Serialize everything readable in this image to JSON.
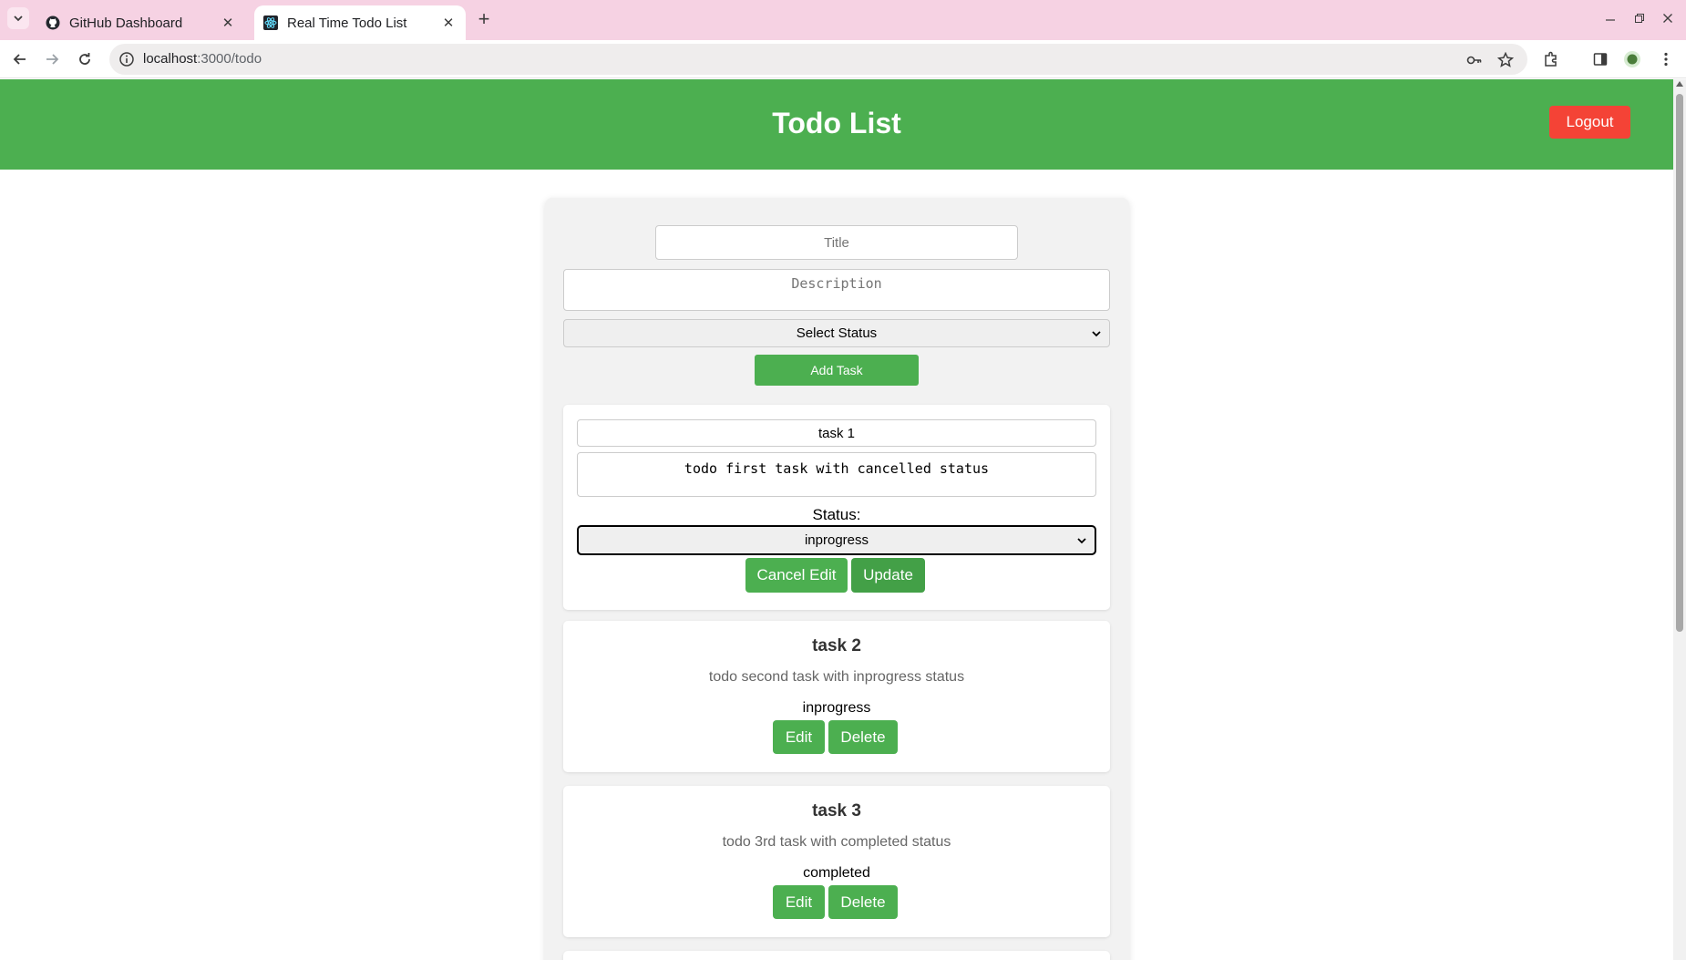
{
  "browser": {
    "tabs": [
      {
        "title": "GitHub Dashboard",
        "icon": "github-icon"
      },
      {
        "title": "Real Time Todo List",
        "icon": "react-icon"
      }
    ],
    "url_host": "localhost",
    "url_path": ":3000/todo"
  },
  "header": {
    "title": "Todo List",
    "logout_label": "Logout"
  },
  "new_task_form": {
    "title_placeholder": "Title",
    "description_placeholder": "Description",
    "status_selected": "Select Status",
    "add_label": "Add Task"
  },
  "editing_task": {
    "title_value": "task 1",
    "description_value": "todo first task with cancelled status",
    "status_label": "Status:",
    "status_selected": "inprogress",
    "cancel_label": "Cancel Edit",
    "update_label": "Update"
  },
  "tasks": [
    {
      "title": "task 2",
      "description": "todo second task with inprogress status",
      "status": "inprogress",
      "edit_label": "Edit",
      "delete_label": "Delete"
    },
    {
      "title": "task 3",
      "description": "todo 3rd task with completed status",
      "status": "completed",
      "edit_label": "Edit",
      "delete_label": "Delete"
    }
  ],
  "colors": {
    "header_green": "#4caf50",
    "logout_red": "#f44336",
    "tab_strip": "#f6d2e3"
  }
}
